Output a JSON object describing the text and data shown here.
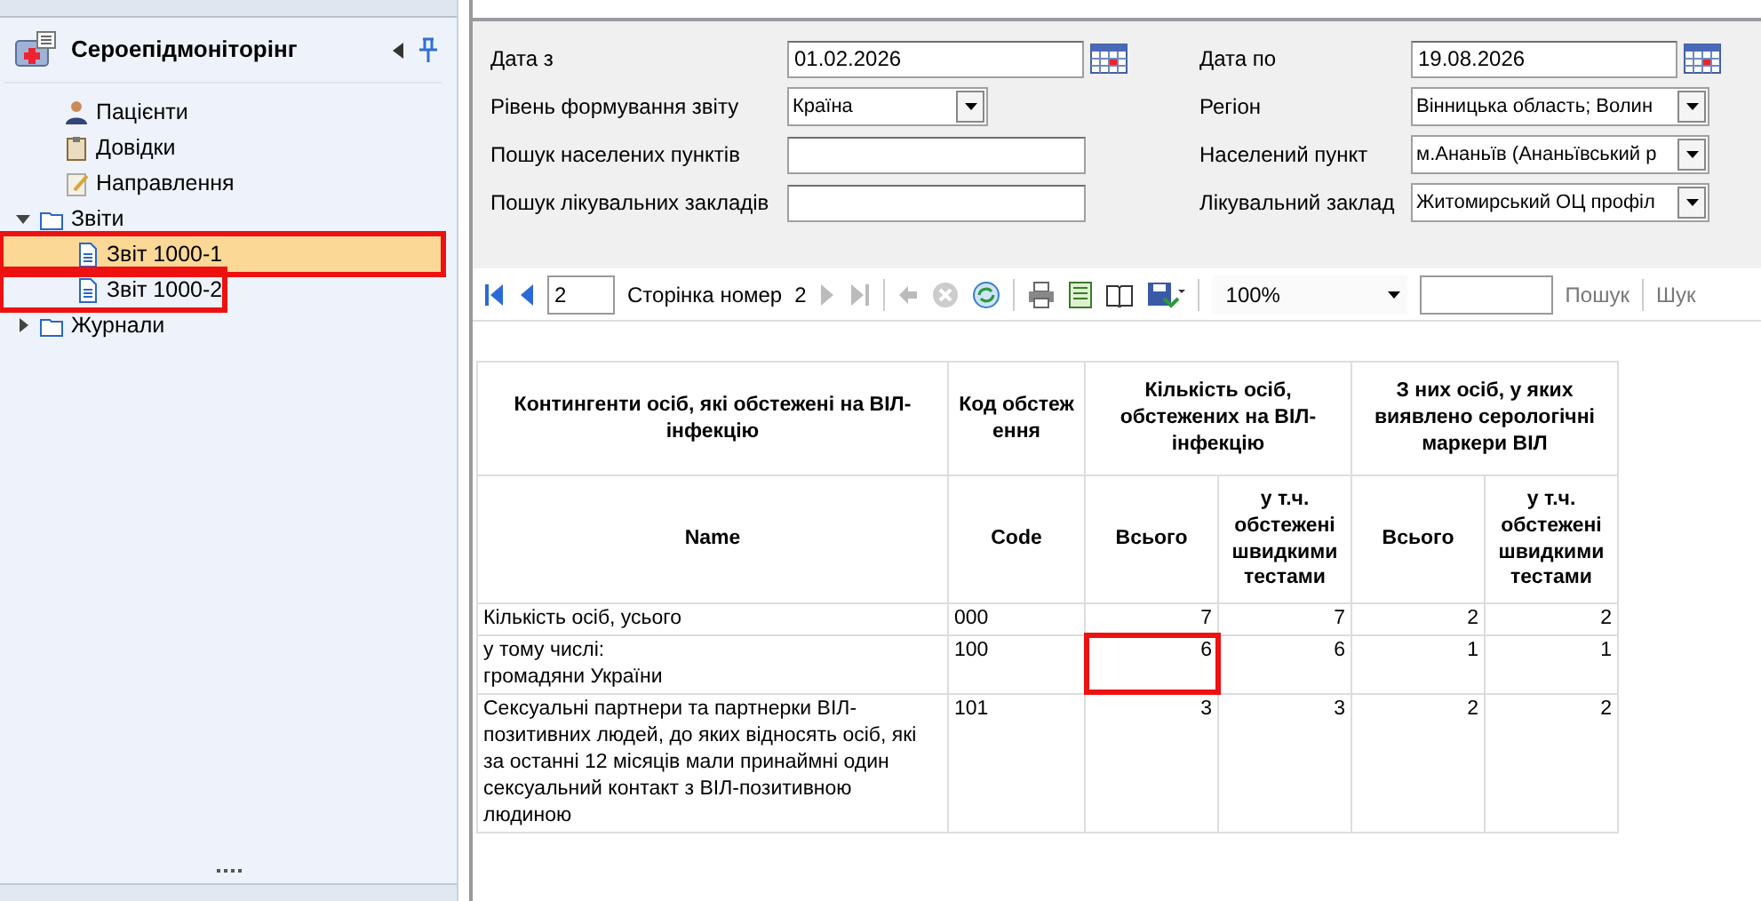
{
  "sidebar": {
    "title": "Сероепідмоніторінг",
    "tree": [
      {
        "label": "Пацієнти",
        "kind": "patient",
        "selected": false,
        "highlighted": false
      },
      {
        "label": "Довідки",
        "kind": "clipboard",
        "selected": false,
        "highlighted": false
      },
      {
        "label": "Направлення",
        "kind": "note",
        "selected": false,
        "highlighted": false
      },
      {
        "label": "Звіти",
        "kind": "folder",
        "expanded": true,
        "selected": false,
        "highlighted": false,
        "children": [
          {
            "label": "Звіт 1000-1",
            "kind": "report",
            "selected": true,
            "highlighted": true
          },
          {
            "label": "Звіт 1000-2",
            "kind": "report",
            "selected": false,
            "highlighted": true
          }
        ]
      },
      {
        "label": "Журнали",
        "kind": "folder",
        "expanded": false,
        "selected": false,
        "highlighted": false
      }
    ]
  },
  "filters": {
    "left": [
      {
        "label": "Дата з",
        "kind": "date",
        "value": "01.02.2026"
      },
      {
        "label": "Рівень формування звіту",
        "kind": "select",
        "value": "Країна"
      },
      {
        "label": "Пошук населених пунктів",
        "kind": "text"
      },
      {
        "label": "Пошук лікувальних закладів",
        "kind": "text"
      }
    ],
    "right": [
      {
        "label": "Дата по",
        "kind": "date",
        "value": "19.08.2026"
      },
      {
        "label": "Регіон",
        "kind": "select",
        "value": "Вінницька область; Волин"
      },
      {
        "label": "Населений пункт",
        "kind": "select",
        "value": "м.Ананьїв (Ананьївський р"
      },
      {
        "label": "Лікувальний заклад",
        "kind": "select",
        "value": "Житомирський ОЦ профіл"
      }
    ]
  },
  "toolbar": {
    "page_field": "2",
    "page_label": "Сторінка номер",
    "page_count": "2",
    "zoom": "100%",
    "search_button": "Пошук",
    "next_button": "Шук"
  },
  "table": {
    "header": [
      {
        "text": "Контингенти осіб, які обстежені на ВІЛ-інфекцію",
        "sub": "Name"
      },
      {
        "text": "Код обстеження",
        "sub": "Code"
      },
      {
        "text": "Кількість осіб, обстежених на ВІЛ-інфекцію",
        "subs": [
          "Всього",
          "у т.ч. обстежені швидкими тестами"
        ]
      },
      {
        "text": "З них осіб, у яких виявлено серологічні маркери ВІЛ",
        "subs": [
          "Всього",
          "у т.ч. обстежені швидкими тестами"
        ]
      }
    ],
    "rows": [
      {
        "name": "Кількість осіб, усього",
        "code": "000",
        "cells": [
          {
            "text": "7",
            "highlighted": false
          },
          {
            "text": "7",
            "highlighted": false
          },
          {
            "text": "2",
            "highlighted": false
          },
          {
            "text": "2",
            "highlighted": false
          }
        ]
      },
      {
        "name": "у тому числі:\nгромадяни України",
        "code": "100",
        "cells": [
          {
            "text": "6",
            "highlighted": true
          },
          {
            "text": "6",
            "highlighted": false
          },
          {
            "text": "1",
            "highlighted": false
          },
          {
            "text": "1",
            "highlighted": false
          }
        ]
      },
      {
        "name": "Сексуальні партнери та партнерки ВІЛ-позитивних людей, до яких відносять осіб, які за останні 12 місяців мали принаймні один сексуальний контакт з ВІЛ-позитивною людиною",
        "code": "101",
        "cells": [
          {
            "text": "3",
            "highlighted": false
          },
          {
            "text": "3",
            "highlighted": false
          },
          {
            "text": "2",
            "highlighted": false
          },
          {
            "text": "2",
            "highlighted": false
          }
        ]
      }
    ]
  }
}
